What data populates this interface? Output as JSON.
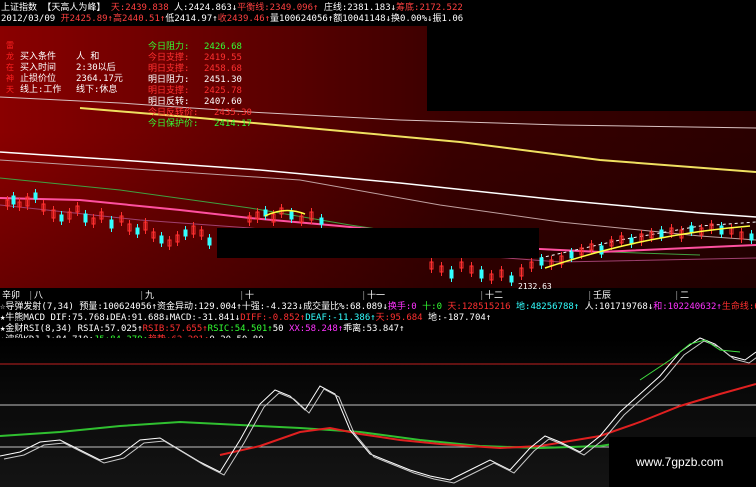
{
  "header": {
    "line1": [
      {
        "t": "上证指数 ",
        "c": "#ffffff"
      },
      {
        "t": "【天高人为峰】",
        "c": "#ffffff"
      },
      {
        "t": " 天:2439.838",
        "c": "#ff4040"
      },
      {
        "t": " 人:2424.863↓",
        "c": "#ffffff"
      },
      {
        "t": "平衡线:2349.096↑",
        "c": "#ff4040"
      },
      {
        "t": " 庄线:2381.183↓",
        "c": "#ffffff"
      },
      {
        "t": "筹底:2172.522",
        "c": "#ff4040"
      }
    ],
    "line2": [
      {
        "t": "2012/03/09",
        "c": "#ffffff"
      },
      {
        "t": " 开2425.89↑",
        "c": "#ff4040"
      },
      {
        "t": "高2440.51↑",
        "c": "#ff4040"
      },
      {
        "t": "低2414.97↑",
        "c": "#ffffff"
      },
      {
        "t": "收2439.46↑",
        "c": "#ff4040"
      },
      {
        "t": "量100624056↑",
        "c": "#ffffff"
      },
      {
        "t": "额10041148↓",
        "c": "#ffffff"
      },
      {
        "t": "换0.00%↓",
        "c": "#ffffff"
      },
      {
        "t": "振1.06",
        "c": "#ffffff"
      }
    ]
  },
  "trade_info": [
    {
      "k": "买入条件",
      "v": "人    和"
    },
    {
      "k": "买入时间",
      "v": "2:30以后"
    },
    {
      "k": "止损价位",
      "v": "2364.17元"
    },
    {
      "k": "线上:工作",
      "v": "线下:休息"
    }
  ],
  "levels": [
    {
      "t": "今日阻力:",
      "v": "2426.68",
      "c": "#33ff33"
    },
    {
      "t": "今日支撑:",
      "v": "2419.55",
      "c": "#ff3030"
    },
    {
      "t": "明日支撑:",
      "v": "2458.68",
      "c": "#ff3030"
    },
    {
      "t": "明日阻力:",
      "v": "2451.30",
      "c": "#ffffff"
    },
    {
      "t": "明日支撑:",
      "v": "2425.78",
      "c": "#ff3030"
    },
    {
      "t": "明日反转:",
      "v": "2407.60",
      "c": "#ffffff"
    },
    {
      "t": "今日反转价:",
      "v": "2435.30",
      "c": "#ff3030"
    },
    {
      "t": "今日保护价:",
      "v": "2414.17",
      "c": "#33ff33"
    }
  ],
  "months": [
    {
      "label": "2011年8月",
      "sep": "八"
    },
    {
      "label": "九",
      "sep": ""
    },
    {
      "label": "十",
      "sep": ""
    },
    {
      "label": "十一",
      "sep": ""
    },
    {
      "label": "十二",
      "sep": ""
    },
    {
      "label": "壬辰",
      "sep": ""
    },
    {
      "label": "二",
      "sep": ""
    }
  ],
  "low_marker": "2132.63",
  "indicators": [
    [
      {
        "t": "☆导弹发射(7,34)",
        "c": "#ffffff"
      },
      {
        "t": " 预量:100624056↑",
        "c": "#ffffff"
      },
      {
        "t": "资金异动:129.004↑",
        "c": "#ffffff"
      },
      {
        "t": "十强:-4.323↓",
        "c": "#ffffff"
      },
      {
        "t": "成交量比%:68.089↓",
        "c": "#ffffff"
      },
      {
        "t": "换手:0",
        "c": "#ff33ff"
      },
      {
        "t": " 十:0",
        "c": "#33ff33"
      },
      {
        "t": " 天:128515216",
        "c": "#ff3030"
      },
      {
        "t": " 地:48256788↑",
        "c": "#33ffff"
      },
      {
        "t": " 人:101719768↓",
        "c": "#ffffff"
      },
      {
        "t": "和:102240632↑",
        "c": "#ff33ff"
      },
      {
        "t": "生命线:61328192↑",
        "c": "#ff3030"
      },
      {
        "t": "股",
        "c": "#ffffff"
      }
    ],
    [
      {
        "t": "★牛熊MACD DIF:75.768↓",
        "c": "#ffffff"
      },
      {
        "t": "DEA:91.688↓",
        "c": "#ffffff"
      },
      {
        "t": "MACD:-31.841↓",
        "c": "#ffffff"
      },
      {
        "t": "DIFF:-0.852↑",
        "c": "#ff3030"
      },
      {
        "t": "DEAF:-11.386↑",
        "c": "#33ffff"
      },
      {
        "t": "天:95.684",
        "c": "#ff3030"
      },
      {
        "t": " 地:-187.704↑",
        "c": "#ffffff"
      }
    ],
    [
      {
        "t": "★金财RSI(8,34)",
        "c": "#ffffff"
      },
      {
        "t": " RSIA:57.025↑",
        "c": "#ffffff"
      },
      {
        "t": "RSIB:57.655↑",
        "c": "#ff3030"
      },
      {
        "t": "RSIC:54.501↑",
        "c": "#33ff33"
      },
      {
        "t": "50",
        "c": "#ffffff"
      },
      {
        "t": " XX:58.248↑",
        "c": "#ff33ff"
      },
      {
        "t": "乖离:53.847↑",
        "c": "#ffffff"
      }
    ],
    [
      {
        "t": "★波段KDJ J:84.710↑",
        "c": "#ffffff"
      },
      {
        "t": "J5:84.379↑",
        "c": "#33ff33"
      },
      {
        "t": "趋势:62.291↑",
        "c": "#ff3030"
      },
      {
        "t": "0",
        "c": "#ffffff"
      },
      {
        "t": " 20",
        "c": "#ffffff"
      },
      {
        "t": " 50",
        "c": "#ffffff"
      },
      {
        "t": " 80",
        "c": "#ffffff"
      }
    ]
  ],
  "side_marks": [
    "雷",
    "龙",
    "在",
    "神",
    "天"
  ],
  "watermark": "www.7gpzb.com",
  "colors": {
    "up": "#ff3030",
    "down": "#33ffff",
    "bg_panel": "#5c0000"
  }
}
